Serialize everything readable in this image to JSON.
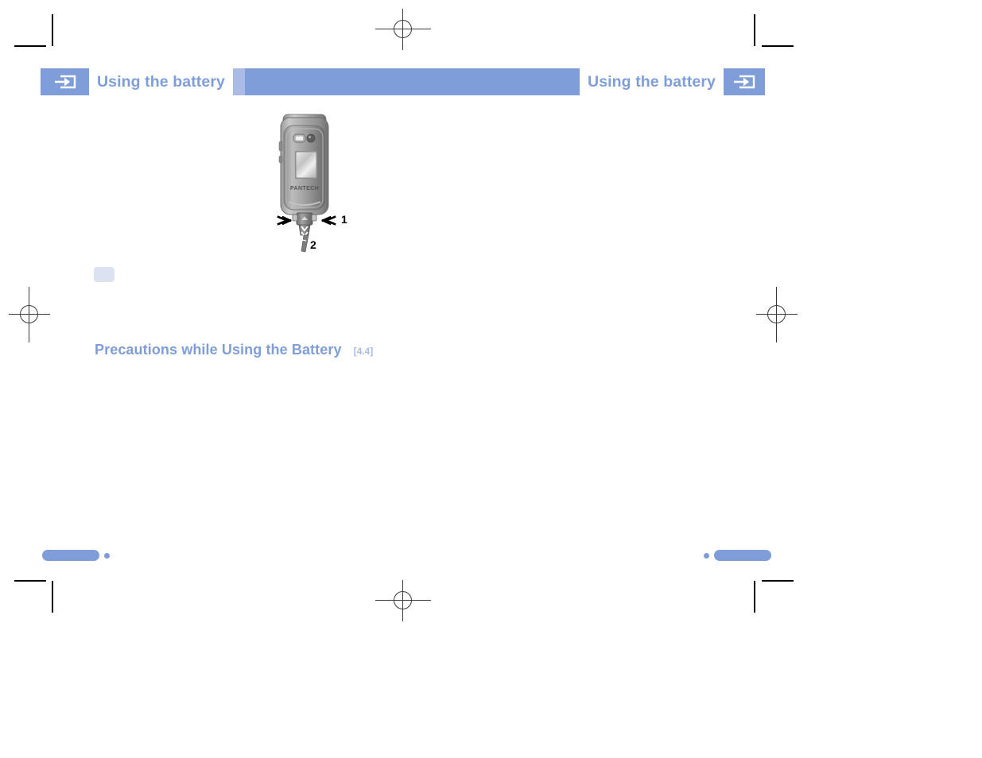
{
  "page": {
    "document_type": "user-manual-page",
    "background_color": "#ffffff",
    "accent_color": "#7f9ed9",
    "accent_light_color": "#aabce6",
    "accent_pale_color": "#dde2f2"
  },
  "header": {
    "left_title": "Using the battery",
    "right_title": "Using the battery",
    "left_icon": "arrow-into-box-icon",
    "right_icon": "arrow-into-box-icon",
    "bar_color": "#7f9ed9",
    "label_text_color": "#7f9ed9",
    "label_background": "#ffffff",
    "divider_color": "#aabce6"
  },
  "figure": {
    "name": "flip-phone-charger-connection-diagram",
    "device_brand": "PANTECH",
    "callouts": [
      {
        "number": "1",
        "direction": "inward-arrows",
        "meaning": "press side latches"
      },
      {
        "number": "2",
        "direction": "downward-arrow",
        "meaning": "pull cable out"
      }
    ]
  },
  "section": {
    "heading": "Precautions while Using the Battery",
    "reference": "[4.4]",
    "heading_color": "#7f9ed9",
    "reference_color": "#a9bde4"
  },
  "footer": {
    "left_marker": {
      "bar": true,
      "dot": true
    },
    "right_marker": {
      "bar": true,
      "dot": true
    },
    "marker_color": "#7f9ed9"
  },
  "print_marks": {
    "corner_crop_marks": 4,
    "registration_targets": 4
  }
}
